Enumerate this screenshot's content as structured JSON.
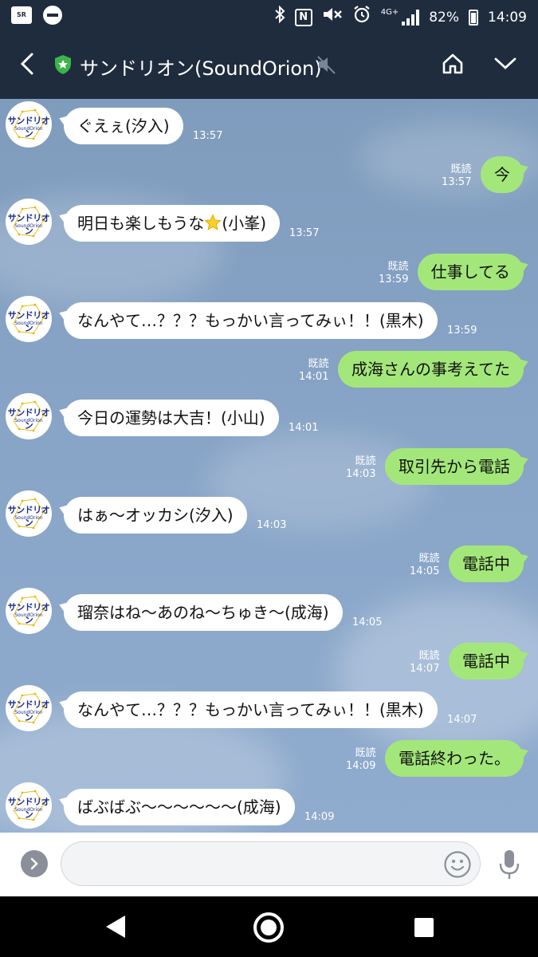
{
  "status_bar": {
    "app_badge": "SR",
    "network": "4G+",
    "battery": "82%",
    "time": "14:09"
  },
  "header": {
    "title": "サンドリオン(SoundOrion)"
  },
  "avatar": {
    "name": "サンドリオン",
    "sub": "SoundOrion"
  },
  "colors": {
    "header_bg": "#1f2c3e",
    "chat_bg": "#86a2c4",
    "outgoing_bubble": "#a3e77a",
    "incoming_bubble": "#ffffff",
    "shield": "#3bb54a"
  },
  "messages": [
    {
      "side": "in",
      "text": "ぐえぇ(汐入)",
      "time": "13:57"
    },
    {
      "side": "out",
      "text": "今",
      "read": "既読",
      "time": "13:57"
    },
    {
      "side": "in",
      "text_before": "明日も楽しもうな",
      "emoji": "star",
      "text_after": "(小峯)",
      "time": "13:57"
    },
    {
      "side": "out",
      "text": "仕事してる",
      "read": "既読",
      "time": "13:59"
    },
    {
      "side": "in",
      "text": "なんやて…？？？もっかい言ってみぃ！！(黒木)",
      "time": "13:59"
    },
    {
      "side": "out",
      "text": "成海さんの事考えてた",
      "read": "既読",
      "time": "14:01"
    },
    {
      "side": "in",
      "text": "今日の運勢は大吉！(小山)",
      "time": "14:01"
    },
    {
      "side": "out",
      "text": "取引先から電話",
      "read": "既読",
      "time": "14:03"
    },
    {
      "side": "in",
      "text": "はぁ〜オッカシ(汐入)",
      "time": "14:03"
    },
    {
      "side": "out",
      "text": "電話中",
      "read": "既読",
      "time": "14:05"
    },
    {
      "side": "in",
      "text": "瑠奈はね〜あのね〜ちゅき〜(成海)",
      "time": "14:05"
    },
    {
      "side": "out",
      "text": "電話中",
      "read": "既読",
      "time": "14:07"
    },
    {
      "side": "in",
      "text": "なんやて…？？？もっかい言ってみぃ！！(黒木)",
      "time": "14:07"
    },
    {
      "side": "out",
      "text": "電話終わった。",
      "read": "既読",
      "time": "14:09"
    },
    {
      "side": "in",
      "text": "ばぶばぶ〜〜〜〜〜〜(成海)",
      "time": "14:09"
    }
  ],
  "icons": {
    "back": "chevron-left-icon",
    "shield": "shield-star-icon",
    "mute": "speaker-muted-icon",
    "home": "home-icon",
    "menu": "chevron-down-icon",
    "expand": "chevron-right-icon",
    "emoji": "smiley-icon",
    "mic": "microphone-icon"
  }
}
